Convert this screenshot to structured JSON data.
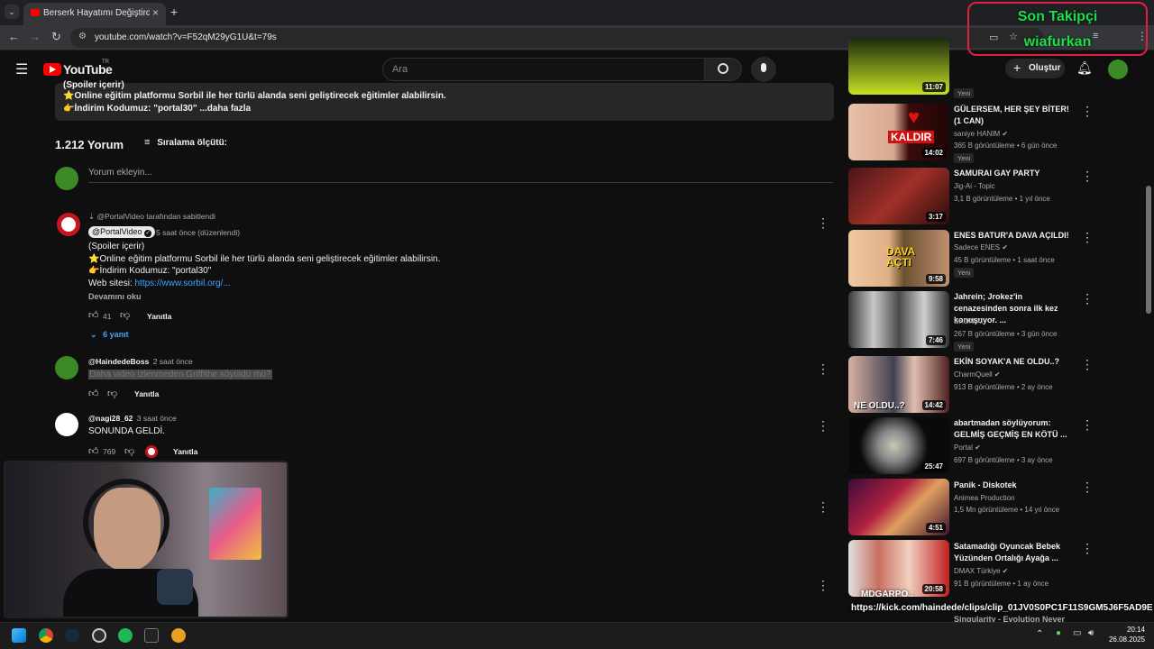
{
  "browser": {
    "tab_title": "Berserk Hayatımı Değiştirdi. - Yo",
    "url": "youtube.com/watch?v=F52qM29yG1U&t=79s",
    "new_tab": "+"
  },
  "overlay": {
    "line1": "Son Takipçi",
    "line2": "wiafurkan"
  },
  "youtube": {
    "logo": "YouTube",
    "region": "TR",
    "search_placeholder": "Ara",
    "create_label": "Oluştur"
  },
  "description": {
    "line0": "(Spoiler içerir)",
    "line1": "⭐Online eğitim platformu Sorbil ile her türlü alanda seni geliştirecek eğitimler alabilirsin.",
    "line2": "👉İndirim Kodumuz: \"portal30\"",
    "more": "...daha fazla"
  },
  "comments_header": {
    "count": "1.212 Yorum",
    "sort_label": "Sıralama ölçütü:",
    "add_placeholder": "Yorum ekleyin..."
  },
  "comments": [
    {
      "pinned": "@PortalVideo tarafından sabitlendi",
      "author": "@PortalVideo",
      "time": "5 saat önce (düzenlendi)",
      "l1": "(Spoiler içerir)",
      "l2": "⭐Online eğitim platformu Sorbil ile her türlü alanda seni geliştirecek eğitimler alabilirsin.",
      "l3": "👉İndirim Kodumuz: \"portal30\"",
      "l4_prefix": "Web sitesi: ",
      "l4_link": "https://www.sorbil.org/...",
      "read_more": "Devamını oku",
      "likes": "41",
      "reply": "Yanıtla",
      "replies": "6 yanıt"
    },
    {
      "author": "@HaindedeBoss",
      "time": "2 saat önce",
      "text": "Daha video izlenmeden Griffithe söyüldü mü?",
      "reply": "Yanıtla"
    },
    {
      "author": "@nagi28_62",
      "time": "3 saat önce",
      "text": "SONUNDA GELDİ.",
      "likes": "769",
      "reply": "Yanıtla"
    }
  ],
  "sidebar": [
    {
      "title": "",
      "channel": "",
      "meta": "",
      "duration": "11:07",
      "badge": "Yeni"
    },
    {
      "title": "GÜLERSEM, HER ŞEY BİTER! (1 CAN)",
      "channel": "saniye HANIM",
      "meta": "365 B görüntüleme • 6 gün önce",
      "duration": "14:02",
      "badge": "Yeni",
      "thumb_text": "KALDIR"
    },
    {
      "title": "SAMURAI GAY PARTY",
      "channel": "Jig-Ai - Topic",
      "meta": "3,1 B görüntüleme • 1 yıl önce",
      "duration": "3:17",
      "badge": ""
    },
    {
      "title": "ENES BATUR'A DAVA AÇILDI!",
      "channel": "Sadece ENES",
      "meta": "45 B görüntüleme • 1 saat önce",
      "duration": "9:58",
      "badge": "Yeni",
      "thumb_text": "DAVA AÇTI"
    },
    {
      "title": "Jahrein; Jrokez'in cenazesinden sonra ilk kez konuşuyor. ...",
      "channel": "EKONIX.",
      "meta": "267 B görüntüleme • 3 gün önce",
      "duration": "7:46",
      "badge": "Yeni"
    },
    {
      "title": "EKİN SOYAK'A NE OLDU..?",
      "channel": "CharmQuell",
      "meta": "913 B görüntüleme • 2 ay önce",
      "duration": "14:42",
      "badge": "",
      "thumb_text": "NE OLDU..?"
    },
    {
      "title": "abartmadan söylüyorum: GELMİŞ GEÇMİŞ EN KÖTÜ ...",
      "channel": "Portal",
      "meta": "697 B görüntüleme • 3 ay önce",
      "duration": "25:47",
      "badge": ""
    },
    {
      "title": "Panik - Diskotek",
      "channel": "Animea Production",
      "meta": "1,5 Mn görüntüleme • 14 yıl önce",
      "duration": "4:51",
      "badge": ""
    },
    {
      "title": "Satamadığı Oyuncak Bebek Yüzünden Ortalığı Ayağa ...",
      "channel": "DMAX Türkiye",
      "meta": "91 B görüntüleme • 1 ay önce",
      "duration": "20:58",
      "badge": ""
    }
  ],
  "clip_overlay": {
    "label": "MDGARPO :",
    "url": "https://kick.com/haindede/clips/clip_01JV0S0PC1F11S9GM5J6F5AD9E",
    "sub": "Singularity - Evolution Never"
  },
  "taskbar": {
    "time": "20:14",
    "date": "26.08.2025"
  },
  "colors": {
    "yt_red": "#ff0000",
    "overlay_green": "#19e046",
    "overlay_border": "#e02040",
    "link": "#3ea6ff"
  }
}
